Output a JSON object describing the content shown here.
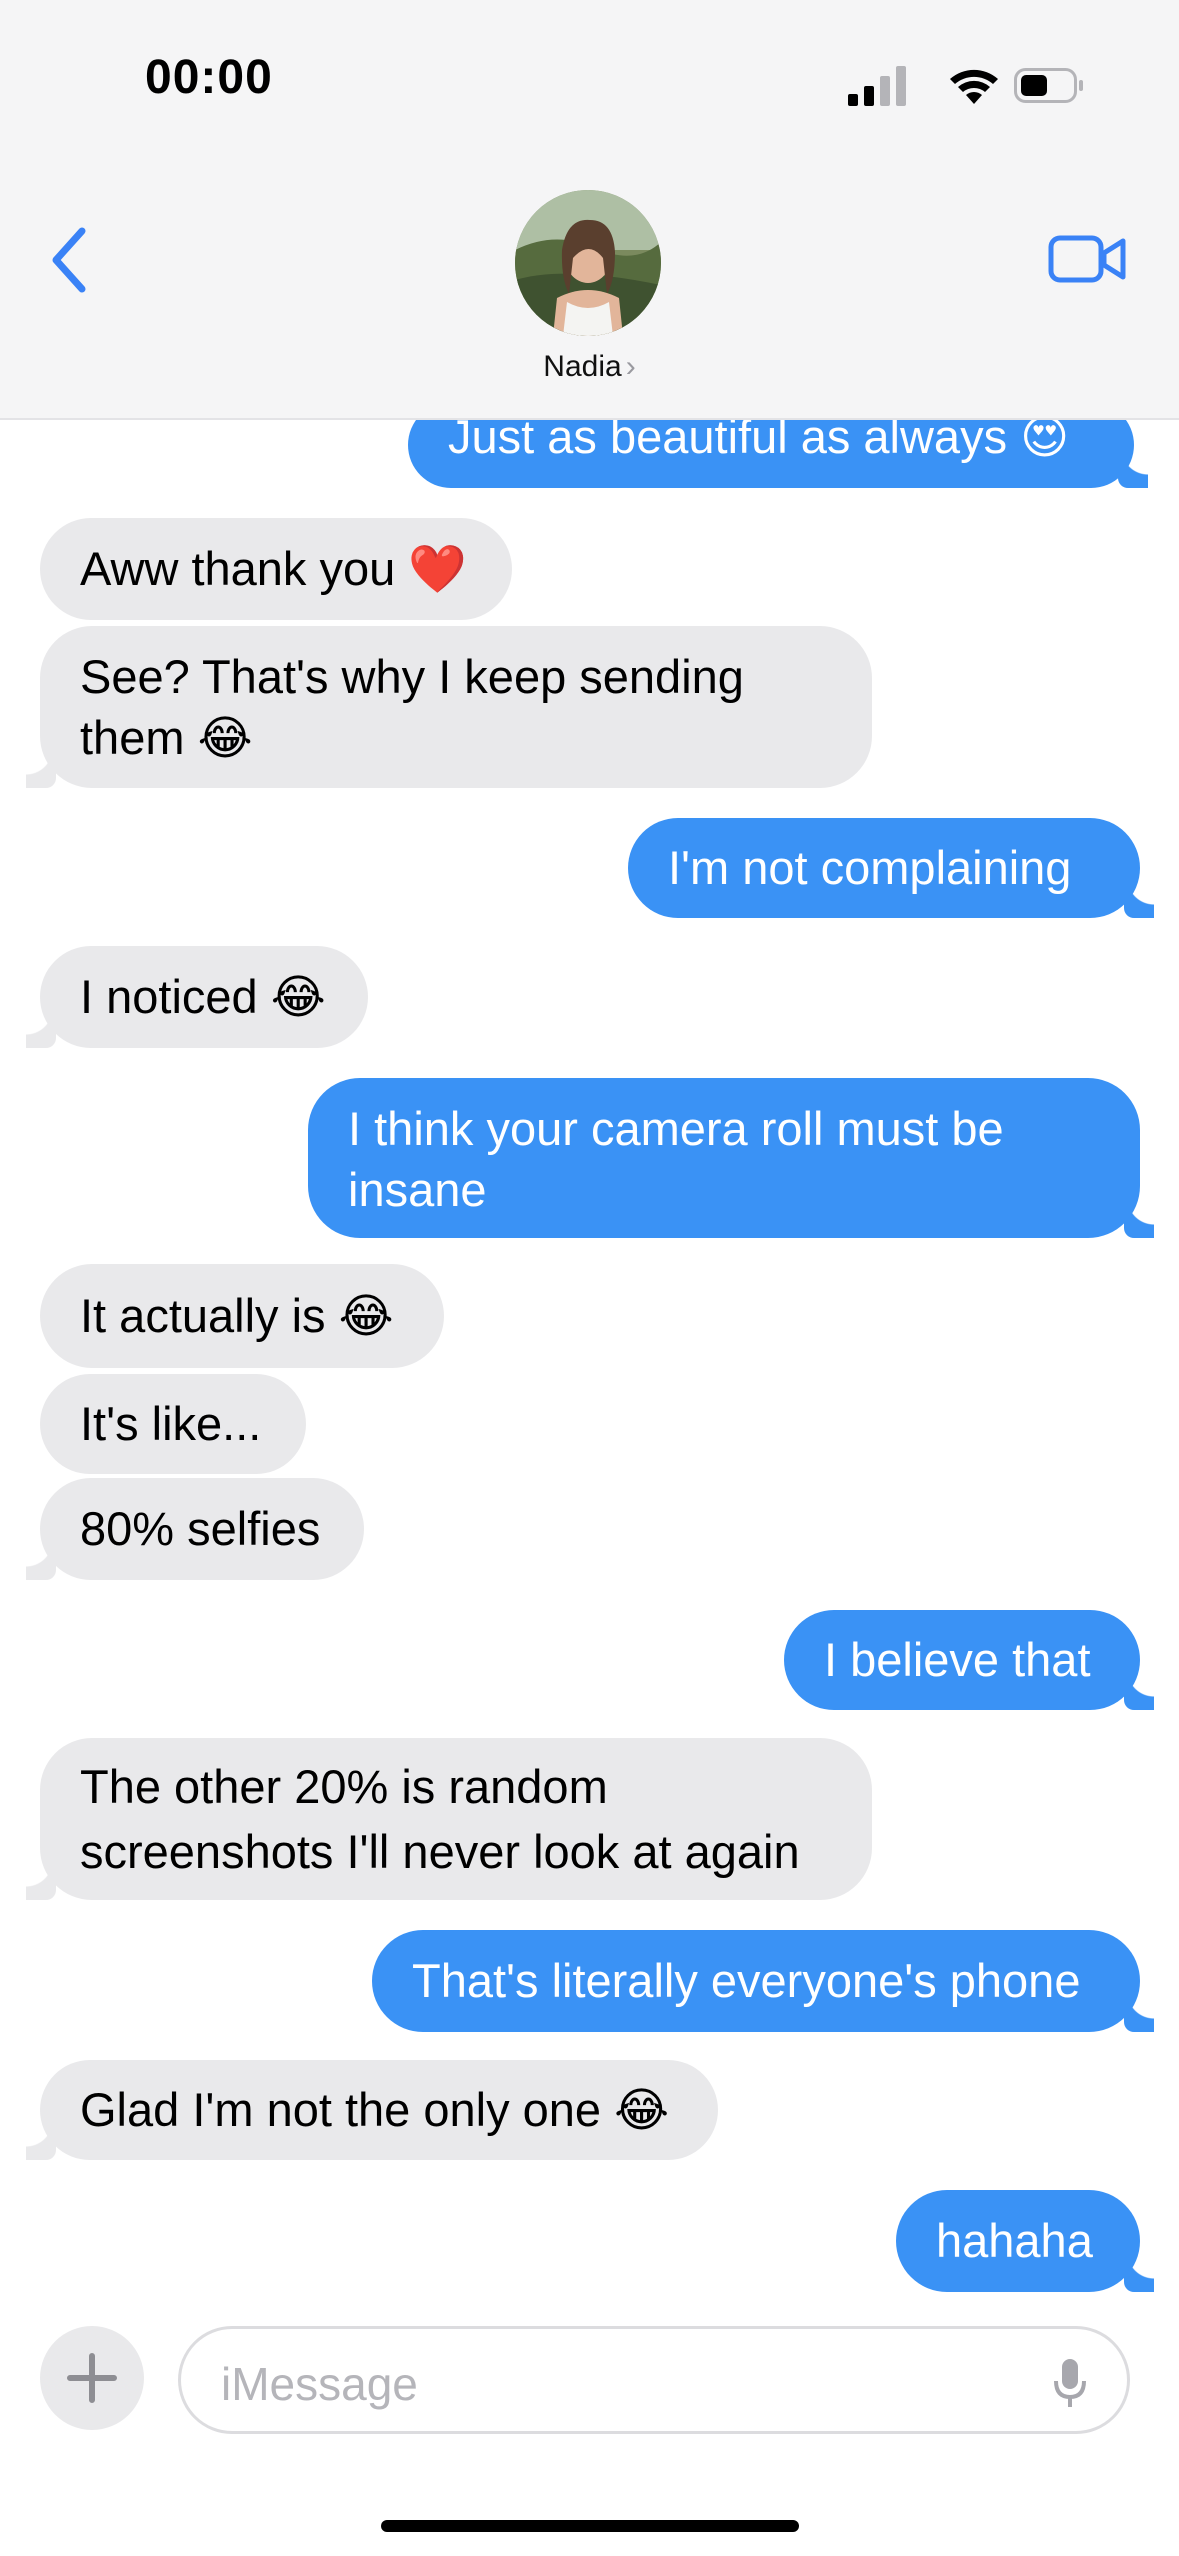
{
  "status_bar": {
    "time": "00:00"
  },
  "header": {
    "contact_name": "Nadia",
    "chevron": "›"
  },
  "messages": [
    {
      "from": "me",
      "text": "Just as beautiful as always",
      "emoji": "😍"
    },
    {
      "from": "them",
      "text": "Aww thank you",
      "emoji": "❤️"
    },
    {
      "from": "them",
      "line1": "See? That's why I keep sending",
      "line2": "them",
      "emoji": "😂"
    },
    {
      "from": "me",
      "text": "I'm not complaining"
    },
    {
      "from": "them",
      "text": "I noticed",
      "emoji": "😂"
    },
    {
      "from": "me",
      "line1": "I think your camera roll must be",
      "line2": "insane"
    },
    {
      "from": "them",
      "text": "It actually is",
      "emoji": "😂"
    },
    {
      "from": "them",
      "text": "It's like..."
    },
    {
      "from": "them",
      "text": "80% selfies"
    },
    {
      "from": "me",
      "text": "I believe that"
    },
    {
      "from": "them",
      "line1": "The other 20% is random",
      "line2": "screenshots I'll never look at again"
    },
    {
      "from": "me",
      "text": "That's literally everyone's phone"
    },
    {
      "from": "them",
      "text": "Glad I'm not the only one",
      "emoji": "😂"
    },
    {
      "from": "me",
      "text": "hahaha"
    }
  ],
  "composer": {
    "placeholder": "iMessage"
  },
  "colors": {
    "sent": "#3a92f5",
    "received": "#e9e9eb",
    "accent": "#3a82f6"
  }
}
